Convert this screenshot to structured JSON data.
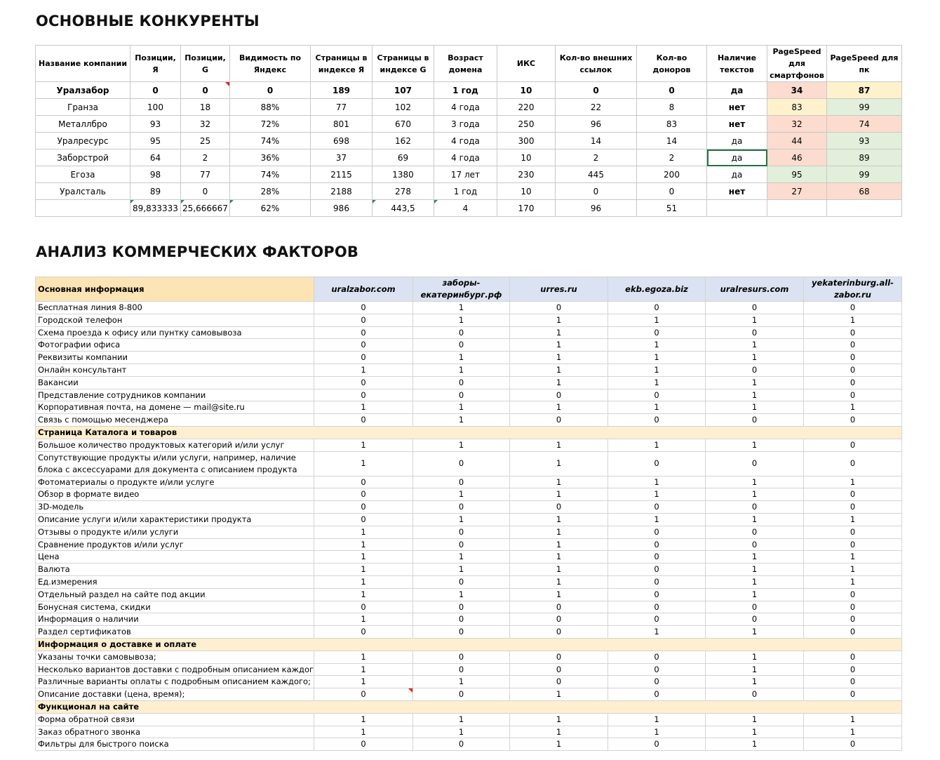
{
  "title1": "ОСНОВНЫЕ КОНКУРЕНТЫ",
  "title2": "АНАЛИЗ КОММЕРЧЕСКИХ ФАКТОРОВ",
  "competitors": {
    "headers": [
      "Название компании",
      "Позиции, Я",
      "Позиции, G",
      "Видимость по Яндекс",
      "Страницы в индексе Я",
      "Страницы в индексе G",
      "Возраст домена",
      "ИКС",
      "Кол-во внешних ссылок",
      "Кол-во доноров",
      "Наличие текстов",
      "PageSpeed для смартфонов",
      "PageSpeed для пк"
    ],
    "rows": [
      [
        "Уралзабор",
        "0",
        "0",
        "0",
        "189",
        "107",
        "1 год",
        "10",
        "0",
        "0",
        "да",
        "34",
        "87"
      ],
      [
        "Гранза",
        "100",
        "18",
        "88%",
        "77",
        "102",
        "4 года",
        "220",
        "22",
        "8",
        "нет",
        "83",
        "99"
      ],
      [
        "Металлбро",
        "93",
        "32",
        "72%",
        "801",
        "670",
        "3 года",
        "250",
        "96",
        "83",
        "нет",
        "32",
        "74"
      ],
      [
        "Уралресурс",
        "95",
        "25",
        "74%",
        "698",
        "162",
        "4 года",
        "300",
        "14",
        "14",
        "да",
        "44",
        "93"
      ],
      [
        "Заборстрой",
        "64",
        "2",
        "36%",
        "37",
        "69",
        "4 года",
        "10",
        "2",
        "2",
        "да",
        "46",
        "89"
      ],
      [
        "Егоза",
        "98",
        "77",
        "74%",
        "2115",
        "1380",
        "17 лет",
        "230",
        "445",
        "200",
        "да",
        "95",
        "99"
      ],
      [
        "Уралсталь",
        "89",
        "0",
        "28%",
        "2188",
        "278",
        "1 год",
        "10",
        "0",
        "0",
        "нет",
        "27",
        "68"
      ],
      [
        "",
        "89,833333",
        "25,666667",
        "62%",
        "986",
        "443,5",
        "4",
        "170",
        "96",
        "51",
        "",
        "",
        ""
      ]
    ]
  },
  "commercial": {
    "header_first": "Основная информация",
    "sites": [
      "uralzabor.com",
      "заборы-екатеринбург.рф",
      "urres.ru",
      "ekb.egoza.biz",
      "uralresurs.com",
      "yekaterinburg.all-zabor.ru"
    ],
    "rows": [
      {
        "label": "Бесплатная линия 8-800",
        "v": [
          "0",
          "1",
          "0",
          "0",
          "0",
          "0"
        ]
      },
      {
        "label": "Городской телефон",
        "v": [
          "0",
          "1",
          "1",
          "1",
          "1",
          "1"
        ]
      },
      {
        "label": "Схема проезда к офису или пунтку самовывоза",
        "v": [
          "0",
          "0",
          "1",
          "0",
          "0",
          "0"
        ]
      },
      {
        "label": "Фотографии офиса",
        "v": [
          "0",
          "0",
          "1",
          "1",
          "1",
          "0"
        ]
      },
      {
        "label": "Реквизиты компании",
        "v": [
          "0",
          "1",
          "1",
          "1",
          "1",
          "0"
        ]
      },
      {
        "label": "Онлайн консультант",
        "v": [
          "1",
          "1",
          "1",
          "1",
          "0",
          "0"
        ]
      },
      {
        "label": "Вакансии",
        "v": [
          "0",
          "0",
          "1",
          "1",
          "1",
          "0"
        ]
      },
      {
        "label": "Представление сотрудников компании",
        "v": [
          "0",
          "0",
          "0",
          "0",
          "1",
          "0"
        ]
      },
      {
        "label": "Корпоративная почта, на домене — mail@site.ru",
        "v": [
          "1",
          "1",
          "1",
          "1",
          "1",
          "1"
        ]
      },
      {
        "label": "Связь с помощью месенджера",
        "v": [
          "0",
          "1",
          "0",
          "0",
          "0",
          "0"
        ]
      },
      {
        "section": "Страница Каталога и товаров"
      },
      {
        "label": "Большое количество продуктовых категорий и/или услуг",
        "v": [
          "1",
          "1",
          "1",
          "1",
          "1",
          "0"
        ]
      },
      {
        "label": "Сопутствующие продукты и/или услуги, например, наличие блока с аксессуарами для документа с описанием продукта",
        "v": [
          "1",
          "0",
          "1",
          "0",
          "0",
          "0"
        ],
        "tall": true
      },
      {
        "label": "Фотоматериалы о продукте и/или услуге",
        "v": [
          "0",
          "0",
          "1",
          "1",
          "1",
          "1"
        ]
      },
      {
        "label": "Обзор в формате видео",
        "v": [
          "0",
          "1",
          "1",
          "1",
          "1",
          "0"
        ]
      },
      {
        "label": "3D-модель",
        "v": [
          "0",
          "0",
          "0",
          "0",
          "0",
          "0"
        ]
      },
      {
        "label": "Описание услуги и/или характеристики продукта",
        "v": [
          "0",
          "1",
          "1",
          "1",
          "1",
          "1"
        ]
      },
      {
        "label": "Отзывы о продукте и/или услуги",
        "v": [
          "1",
          "0",
          "1",
          "0",
          "0",
          "0"
        ]
      },
      {
        "label": "Сравнение продуктов и/или услуг",
        "v": [
          "1",
          "0",
          "1",
          "0",
          "0",
          "0"
        ]
      },
      {
        "label": "Цена",
        "v": [
          "1",
          "1",
          "1",
          "0",
          "1",
          "1"
        ]
      },
      {
        "label": "Валюта",
        "v": [
          "1",
          "1",
          "1",
          "0",
          "1",
          "1"
        ]
      },
      {
        "label": "Ед.измерения",
        "v": [
          "1",
          "0",
          "1",
          "0",
          "1",
          "1"
        ]
      },
      {
        "label": "Отдельный раздел на сайте под акции",
        "v": [
          "1",
          "1",
          "1",
          "0",
          "1",
          "0"
        ]
      },
      {
        "label": "Бонусная система, скидки",
        "v": [
          "0",
          "0",
          "0",
          "0",
          "0",
          "0"
        ]
      },
      {
        "label": "Информация о наличии",
        "v": [
          "1",
          "0",
          "0",
          "0",
          "0",
          "0"
        ]
      },
      {
        "label": "Раздел сертификатов",
        "v": [
          "0",
          "0",
          "0",
          "1",
          "1",
          "0"
        ]
      },
      {
        "section": "Информация о доставке и оплате"
      },
      {
        "label": "Указаны точки самовывоза;",
        "v": [
          "1",
          "0",
          "0",
          "0",
          "1",
          "0"
        ]
      },
      {
        "label": "Несколько вариантов доставки с подробным описанием каждого;",
        "v": [
          "1",
          "0",
          "0",
          "0",
          "1",
          "0"
        ]
      },
      {
        "label": "Различные варианты оплаты с подробным описанием каждого;",
        "v": [
          "1",
          "1",
          "0",
          "0",
          "1",
          "0"
        ]
      },
      {
        "label": "Описание доставки (цена, время);",
        "v": [
          "0",
          "0",
          "1",
          "0",
          "0",
          "0"
        ]
      },
      {
        "section": "Функционал на сайте"
      },
      {
        "label": "Форма обратной связи",
        "v": [
          "1",
          "1",
          "1",
          "1",
          "1",
          "1"
        ]
      },
      {
        "label": "Заказ обратного звонка",
        "v": [
          "1",
          "1",
          "1",
          "1",
          "1",
          "1"
        ]
      },
      {
        "label": "Фильтры для быстрого поиска",
        "v": [
          "0",
          "0",
          "1",
          "0",
          "1",
          "0"
        ]
      }
    ]
  },
  "colors": {
    "red": "#fbdccf",
    "yellow": "#fef2cc",
    "green": "#e2efda",
    "section": "#fdefcf",
    "site_header": "#dbe2f1"
  }
}
